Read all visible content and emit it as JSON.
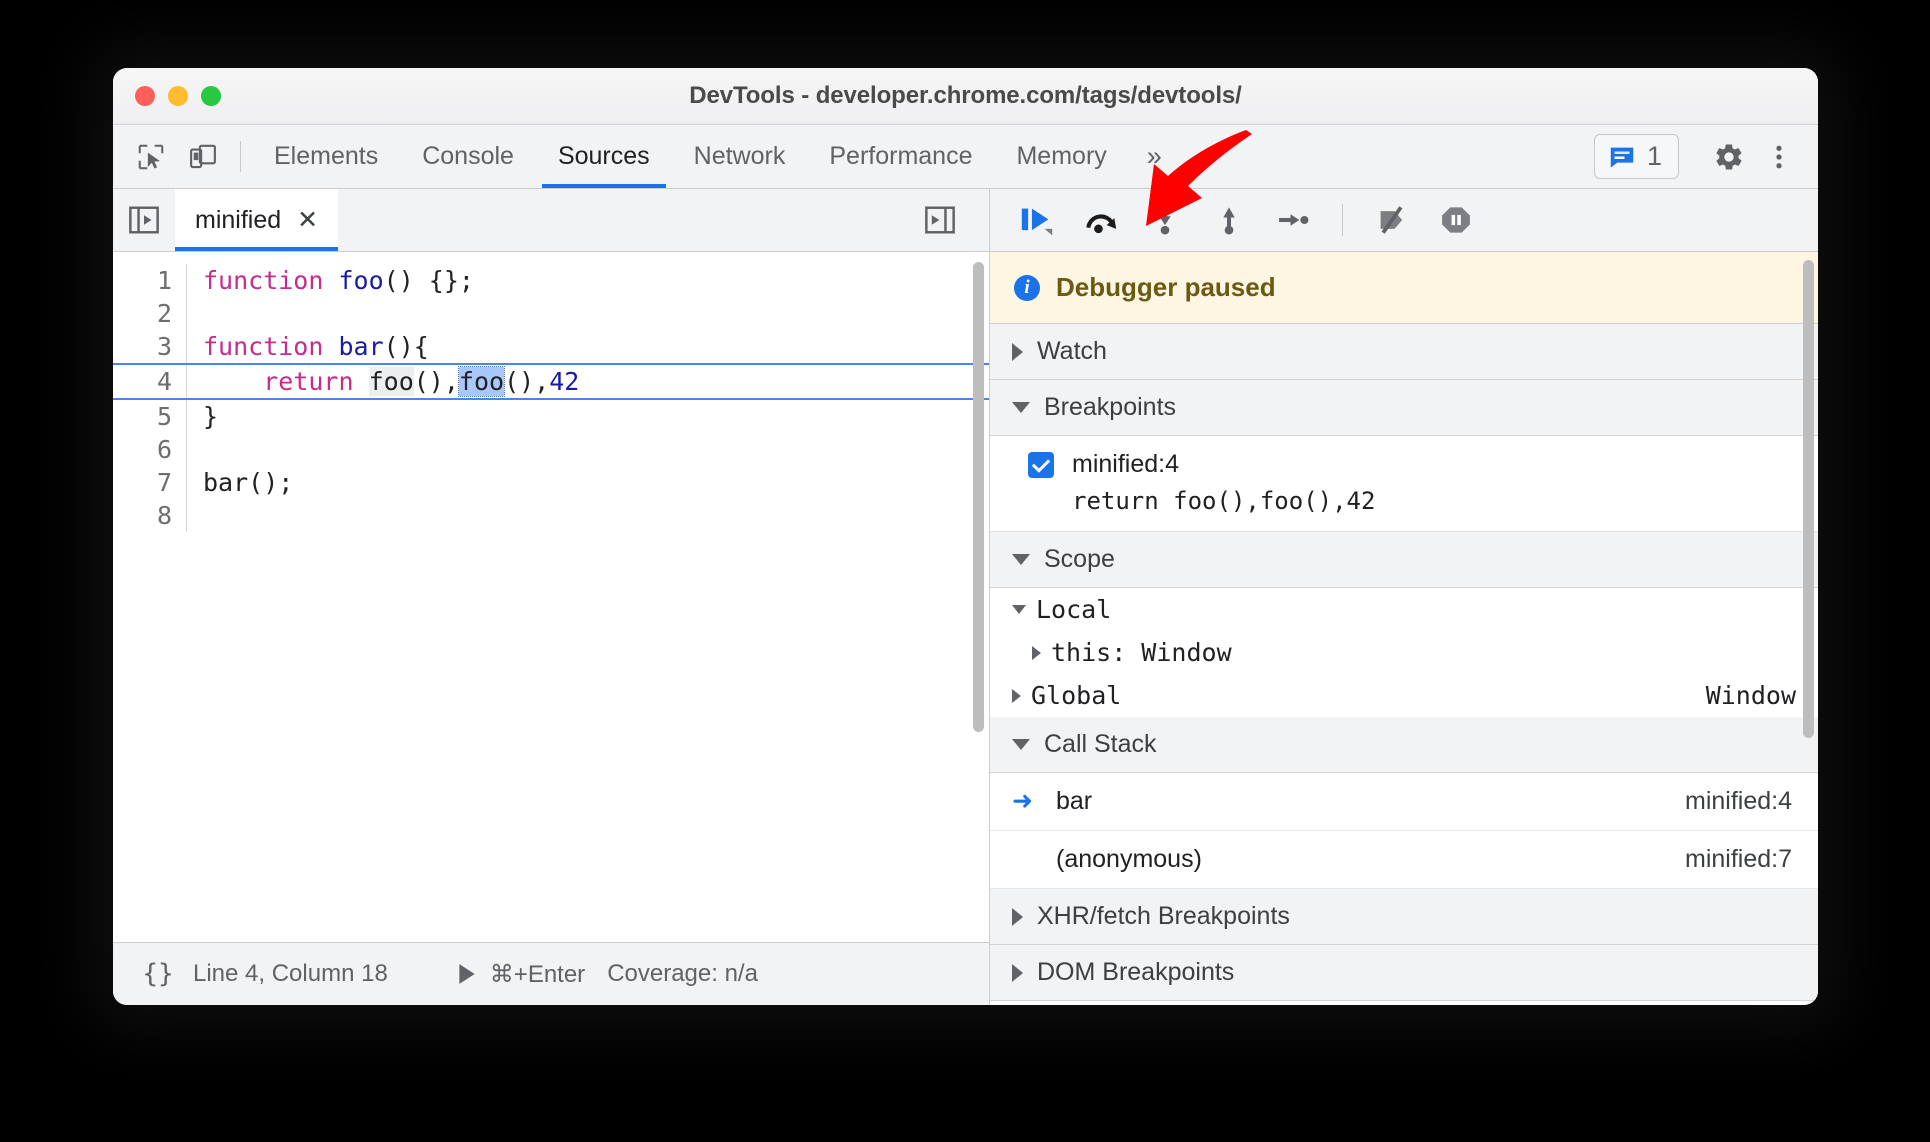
{
  "window": {
    "title": "DevTools - developer.chrome.com/tags/devtools/",
    "traffic_lights": [
      "close",
      "minimize",
      "maximize"
    ]
  },
  "toolbar": {
    "inspect_icon": "inspect-cursor-icon",
    "device_icon": "device-toolbar-icon",
    "tabs": [
      {
        "label": "Elements",
        "active": false
      },
      {
        "label": "Console",
        "active": false
      },
      {
        "label": "Sources",
        "active": true
      },
      {
        "label": "Network",
        "active": false
      },
      {
        "label": "Performance",
        "active": false
      },
      {
        "label": "Memory",
        "active": false
      }
    ],
    "more_tabs_label": "»",
    "issues_count": "1",
    "issues_icon": "issues-message-icon",
    "settings_icon": "gear-icon",
    "menu_icon": "kebab-menu-icon"
  },
  "editor_pane": {
    "navigator_toggle_icon": "show-navigator-icon",
    "file_tab": {
      "label": "minified",
      "close_label": "✕"
    },
    "right_toggle_icon": "show-debugger-icon",
    "lines": [
      {
        "n": "1",
        "segments": [
          {
            "t": "function",
            "c": "kw"
          },
          {
            "t": " "
          },
          {
            "t": "foo",
            "c": "fn"
          },
          {
            "t": "() {};"
          }
        ]
      },
      {
        "n": "2",
        "segments": []
      },
      {
        "n": "3",
        "segments": [
          {
            "t": "function",
            "c": "kw"
          },
          {
            "t": " "
          },
          {
            "t": "bar",
            "c": "fn"
          },
          {
            "t": "(){"
          }
        ]
      },
      {
        "n": "4",
        "exec": true,
        "segments": [
          {
            "t": "    "
          },
          {
            "t": "return",
            "c": "kw"
          },
          {
            "t": " "
          },
          {
            "t": "foo",
            "c": "hl-gray"
          },
          {
            "t": "(),"
          },
          {
            "t": "foo",
            "c": "hl-blue"
          },
          {
            "t": "(),"
          },
          {
            "t": "42",
            "c": "num"
          }
        ]
      },
      {
        "n": "5",
        "segments": [
          {
            "t": "}"
          }
        ]
      },
      {
        "n": "6",
        "segments": []
      },
      {
        "n": "7",
        "segments": [
          {
            "t": "bar();"
          }
        ]
      },
      {
        "n": "8",
        "segments": []
      }
    ]
  },
  "statusbar": {
    "format_icon_label": "{}",
    "position": "Line 4, Column 18",
    "run_icon": "run-snippet-icon",
    "run_shortcut": "⌘+Enter",
    "coverage": "Coverage: n/a"
  },
  "debugger": {
    "toolbar_buttons": [
      {
        "name": "resume-script-execution",
        "icon": "resume-icon"
      },
      {
        "name": "step-over-next-function-call",
        "icon": "step-over-icon"
      },
      {
        "name": "step-into-next-function-call",
        "icon": "step-into-icon"
      },
      {
        "name": "step-out-of-current-function",
        "icon": "step-out-icon"
      },
      {
        "name": "step",
        "icon": "step-icon"
      },
      {
        "name": "deactivate-breakpoints",
        "icon": "deactivate-breakpoints-icon"
      },
      {
        "name": "pause-on-exceptions",
        "icon": "pause-on-exceptions-icon"
      }
    ],
    "paused_banner": {
      "icon": "info-icon",
      "text": "Debugger paused"
    },
    "sections": {
      "watch": {
        "label": "Watch",
        "expanded": false
      },
      "breakpoints": {
        "label": "Breakpoints",
        "expanded": true,
        "items": [
          {
            "checked": true,
            "label": "minified:4",
            "code": "return foo(),foo(),42"
          }
        ]
      },
      "scope": {
        "label": "Scope",
        "expanded": true,
        "rows": [
          {
            "indent": 0,
            "expanded": true,
            "text": "Local",
            "value": ""
          },
          {
            "indent": 1,
            "expanded": false,
            "text": "this: Window",
            "value": ""
          },
          {
            "indent": 0,
            "expanded": false,
            "text": "Global",
            "value": "Window"
          }
        ]
      },
      "call_stack": {
        "label": "Call Stack",
        "expanded": true,
        "frames": [
          {
            "selected": true,
            "name": "bar",
            "location": "minified:4"
          },
          {
            "selected": false,
            "name": "(anonymous)",
            "location": "minified:7"
          }
        ]
      },
      "xhr_breakpoints": {
        "label": "XHR/fetch Breakpoints",
        "expanded": false
      },
      "dom_breakpoints": {
        "label": "DOM Breakpoints",
        "expanded": false
      }
    }
  },
  "annotation": {
    "arrow_color": "#ff0000",
    "points_to": "step-into-next-function-call"
  }
}
